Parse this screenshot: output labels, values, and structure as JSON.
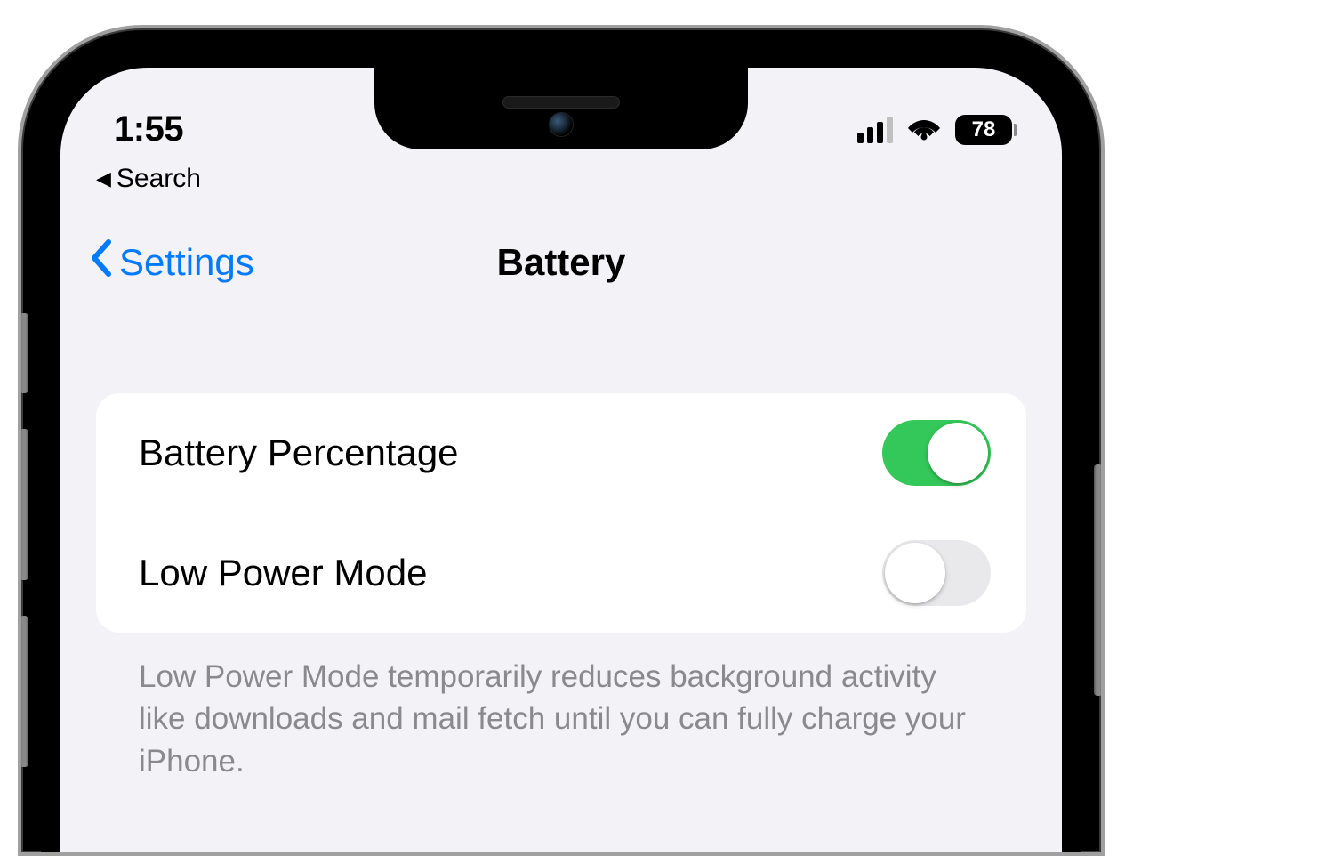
{
  "status_bar": {
    "time": "1:55",
    "battery_percentage": "78",
    "cellular_strength": 3
  },
  "breadcrumb": {
    "label": "Search"
  },
  "nav": {
    "back_label": "Settings",
    "title": "Battery"
  },
  "settings": {
    "rows": [
      {
        "label": "Battery Percentage",
        "on": true
      },
      {
        "label": "Low Power Mode",
        "on": false
      }
    ],
    "footer": "Low Power Mode temporarily reduces background activity like downloads and mail fetch until you can fully charge your iPhone."
  },
  "colors": {
    "accent": "#007aff",
    "toggle_on": "#34c759",
    "background": "#f2f2f7"
  }
}
